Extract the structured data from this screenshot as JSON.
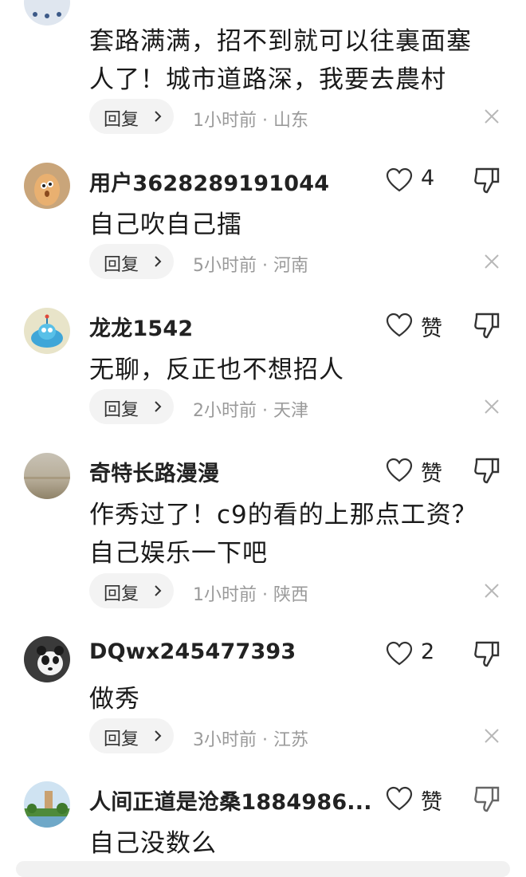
{
  "comments": [
    {
      "username": "",
      "text_lines": [
        "套路满满，招不到就可以往裏面塞",
        "人了！城市道路深，我要去農村"
      ],
      "like_label": "",
      "meta": "1小时前 · 山东",
      "reply_label": "回复"
    },
    {
      "username": "用户3628289191044",
      "text_lines": [
        "自己吹自己擂"
      ],
      "like_label": "4",
      "meta": "5小时前 · 河南",
      "reply_label": "回复"
    },
    {
      "username": "龙龙1542",
      "text_lines": [
        "无聊，反正也不想招人"
      ],
      "like_label": "赞",
      "meta": "2小时前 · 天津",
      "reply_label": "回复"
    },
    {
      "username": "奇特长路漫漫",
      "text_lines": [
        "作秀过了！c9的看的上那点工资？",
        "自己娱乐一下吧"
      ],
      "like_label": "赞",
      "meta": "1小时前 · 陕西",
      "reply_label": "回复"
    },
    {
      "username": "DQwx245477393",
      "text_lines": [
        "做秀"
      ],
      "like_label": "2",
      "meta": "3小时前 · 江苏",
      "reply_label": "回复"
    },
    {
      "username": "人间正道是沧桑1884986...",
      "text_lines": [
        "自己没数么"
      ],
      "like_label": "赞",
      "meta": "",
      "reply_label": ""
    }
  ],
  "icons": {
    "like": "heart-outline-icon",
    "dislike": "thumbs-down-icon",
    "close": "close-icon",
    "reply_chevron": "chevron-right-icon"
  },
  "colors": {
    "text": "#1a1a1a",
    "meta": "#9a9a9a",
    "reply_bg": "#f3f3f3",
    "icon": "#333333",
    "close": "#b8b8b8"
  }
}
